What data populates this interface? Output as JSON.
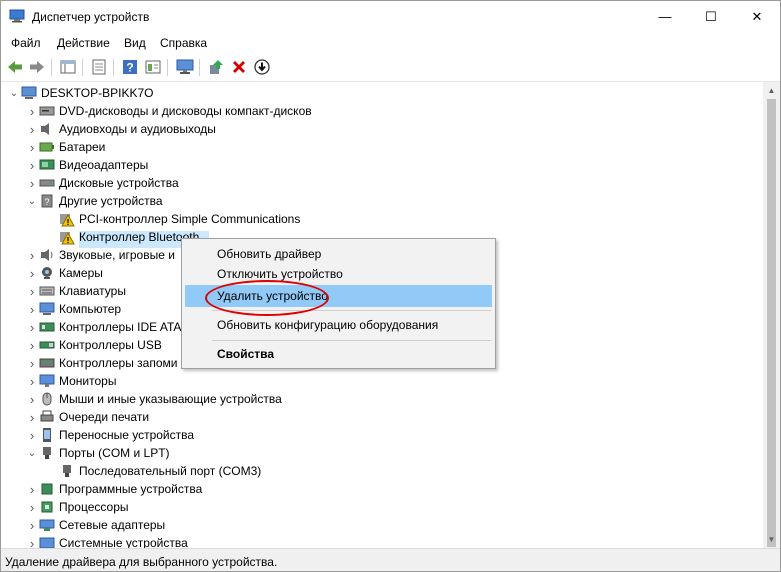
{
  "window": {
    "title": "Диспетчер устройств",
    "minimize_glyph": "—",
    "maximize_glyph": "☐",
    "close_glyph": "✕"
  },
  "menu": [
    "Файл",
    "Действие",
    "Вид",
    "Справка"
  ],
  "tree": {
    "root": "DESKTOP-BPIKK7O",
    "items": [
      {
        "label": "DVD-дисководы и дисководы компакт-дисков",
        "icon": "dvd-drive-icon",
        "expanded": false
      },
      {
        "label": "Аудиовходы и аудиовыходы",
        "icon": "speaker-icon",
        "expanded": false
      },
      {
        "label": "Батареи",
        "icon": "battery-icon",
        "expanded": false
      },
      {
        "label": "Видеоадаптеры",
        "icon": "display-adapter-icon",
        "expanded": false
      },
      {
        "label": "Дисковые устройства",
        "icon": "disk-drive-icon",
        "expanded": false
      },
      {
        "label": "Другие устройства",
        "icon": "unknown-device-icon",
        "expanded": true
      },
      {
        "label": "PCI-контроллер Simple Communications",
        "icon": "warning-device-icon",
        "child": true
      },
      {
        "label": "Контроллер Bluetooth",
        "icon": "warning-device-icon",
        "child": true,
        "selected": true
      },
      {
        "label": "Звуковые, игровые и",
        "icon": "sound-icon",
        "expanded": false
      },
      {
        "label": "Камеры",
        "icon": "camera-icon",
        "expanded": false
      },
      {
        "label": "Клавиатуры",
        "icon": "keyboard-icon",
        "expanded": false
      },
      {
        "label": "Компьютер",
        "icon": "computer-icon",
        "expanded": false
      },
      {
        "label": "Контроллеры IDE ATA",
        "icon": "ide-controller-icon",
        "expanded": false
      },
      {
        "label": "Контроллеры USB",
        "icon": "usb-icon",
        "expanded": false
      },
      {
        "label": "Контроллеры запоми",
        "icon": "storage-controller-icon",
        "expanded": false
      },
      {
        "label": "Мониторы",
        "icon": "monitor-icon",
        "expanded": false
      },
      {
        "label": "Мыши и иные указывающие устройства",
        "icon": "mouse-icon",
        "expanded": false
      },
      {
        "label": "Очереди печати",
        "icon": "printer-icon",
        "expanded": false
      },
      {
        "label": "Переносные устройства",
        "icon": "portable-device-icon",
        "expanded": false
      },
      {
        "label": "Порты (COM и LPT)",
        "icon": "port-icon",
        "expanded": true
      },
      {
        "label": "Последовательный порт (COM3)",
        "icon": "port-icon",
        "child": true
      },
      {
        "label": "Программные устройства",
        "icon": "software-device-icon",
        "expanded": false
      },
      {
        "label": "Процессоры",
        "icon": "cpu-icon",
        "expanded": false
      },
      {
        "label": "Сетевые адаптеры",
        "icon": "network-adapter-icon",
        "expanded": false
      },
      {
        "label": "Системные устройства",
        "icon": "system-device-icon",
        "expanded": false
      }
    ]
  },
  "context_menu": {
    "items": [
      {
        "label": "Обновить драйвер"
      },
      {
        "label": "Отключить устройство"
      },
      {
        "label": "Удалить устройство",
        "highlighted": true
      },
      {
        "label": "Обновить конфигурацию оборудования"
      },
      {
        "label": "Свойства",
        "bold": true
      }
    ]
  },
  "status": "Удаление драйвера для выбранного устройства.",
  "colors": {
    "highlight": "#91c9f7",
    "selection": "#cce8ff",
    "annotation": "#e00000",
    "delete_red": "#d40000"
  }
}
